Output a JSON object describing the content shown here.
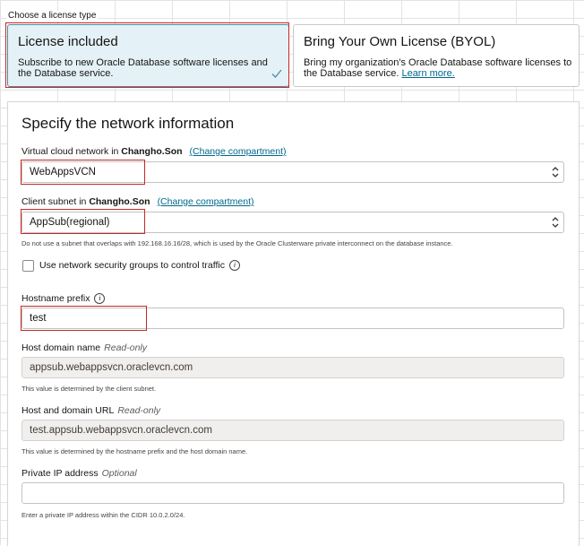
{
  "license": {
    "section_label": "Choose a license type",
    "options": [
      {
        "title": "License included",
        "description": "Subscribe to new Oracle Database software licenses and the Database service.",
        "selected": true
      },
      {
        "title": "Bring Your Own License (BYOL)",
        "description": "Bring my organization's Oracle Database software licenses to the Database service.",
        "link": "Learn more.",
        "selected": false
      }
    ]
  },
  "network": {
    "title": "Specify the network information",
    "vcn": {
      "label_prefix": "Virtual cloud network in",
      "compartment": "Changho.Son",
      "change_link": "(Change compartment)",
      "value": "WebAppsVCN"
    },
    "subnet": {
      "label_prefix": "Client subnet in",
      "compartment": "Changho.Son",
      "change_link": "(Change compartment)",
      "value": "AppSub(regional)",
      "help": "Do not use a subnet that overlaps with 192.168.16.16/28, which is used by the Oracle Clusterware private interconnect on the database instance."
    },
    "nsg": {
      "label": "Use network security groups to control traffic",
      "checked": false
    },
    "hostname": {
      "label": "Hostname prefix",
      "value": "test"
    },
    "host_domain": {
      "label": "Host domain name",
      "qualifier": "Read-only",
      "value": "appsub.webappsvcn.oraclevcn.com",
      "help": "This value is determined by the client subnet."
    },
    "host_url": {
      "label": "Host and domain URL",
      "qualifier": "Read-only",
      "value": "test.appsub.webappsvcn.oraclevcn.com",
      "help": "This value is determined by the hostname prefix and the host domain name."
    },
    "private_ip": {
      "label": "Private IP address",
      "qualifier": "Optional",
      "value": "",
      "help": "Enter a private IP address within the CIDR 10.0.2.0/24."
    }
  },
  "colors": {
    "highlight": "#c62828",
    "selected_bg": "#e4f1f7",
    "link": "#00688c"
  },
  "icons": {
    "selected_check": "check-icon",
    "select_arrows": "up-down-arrows-icon",
    "info": "info-icon"
  }
}
